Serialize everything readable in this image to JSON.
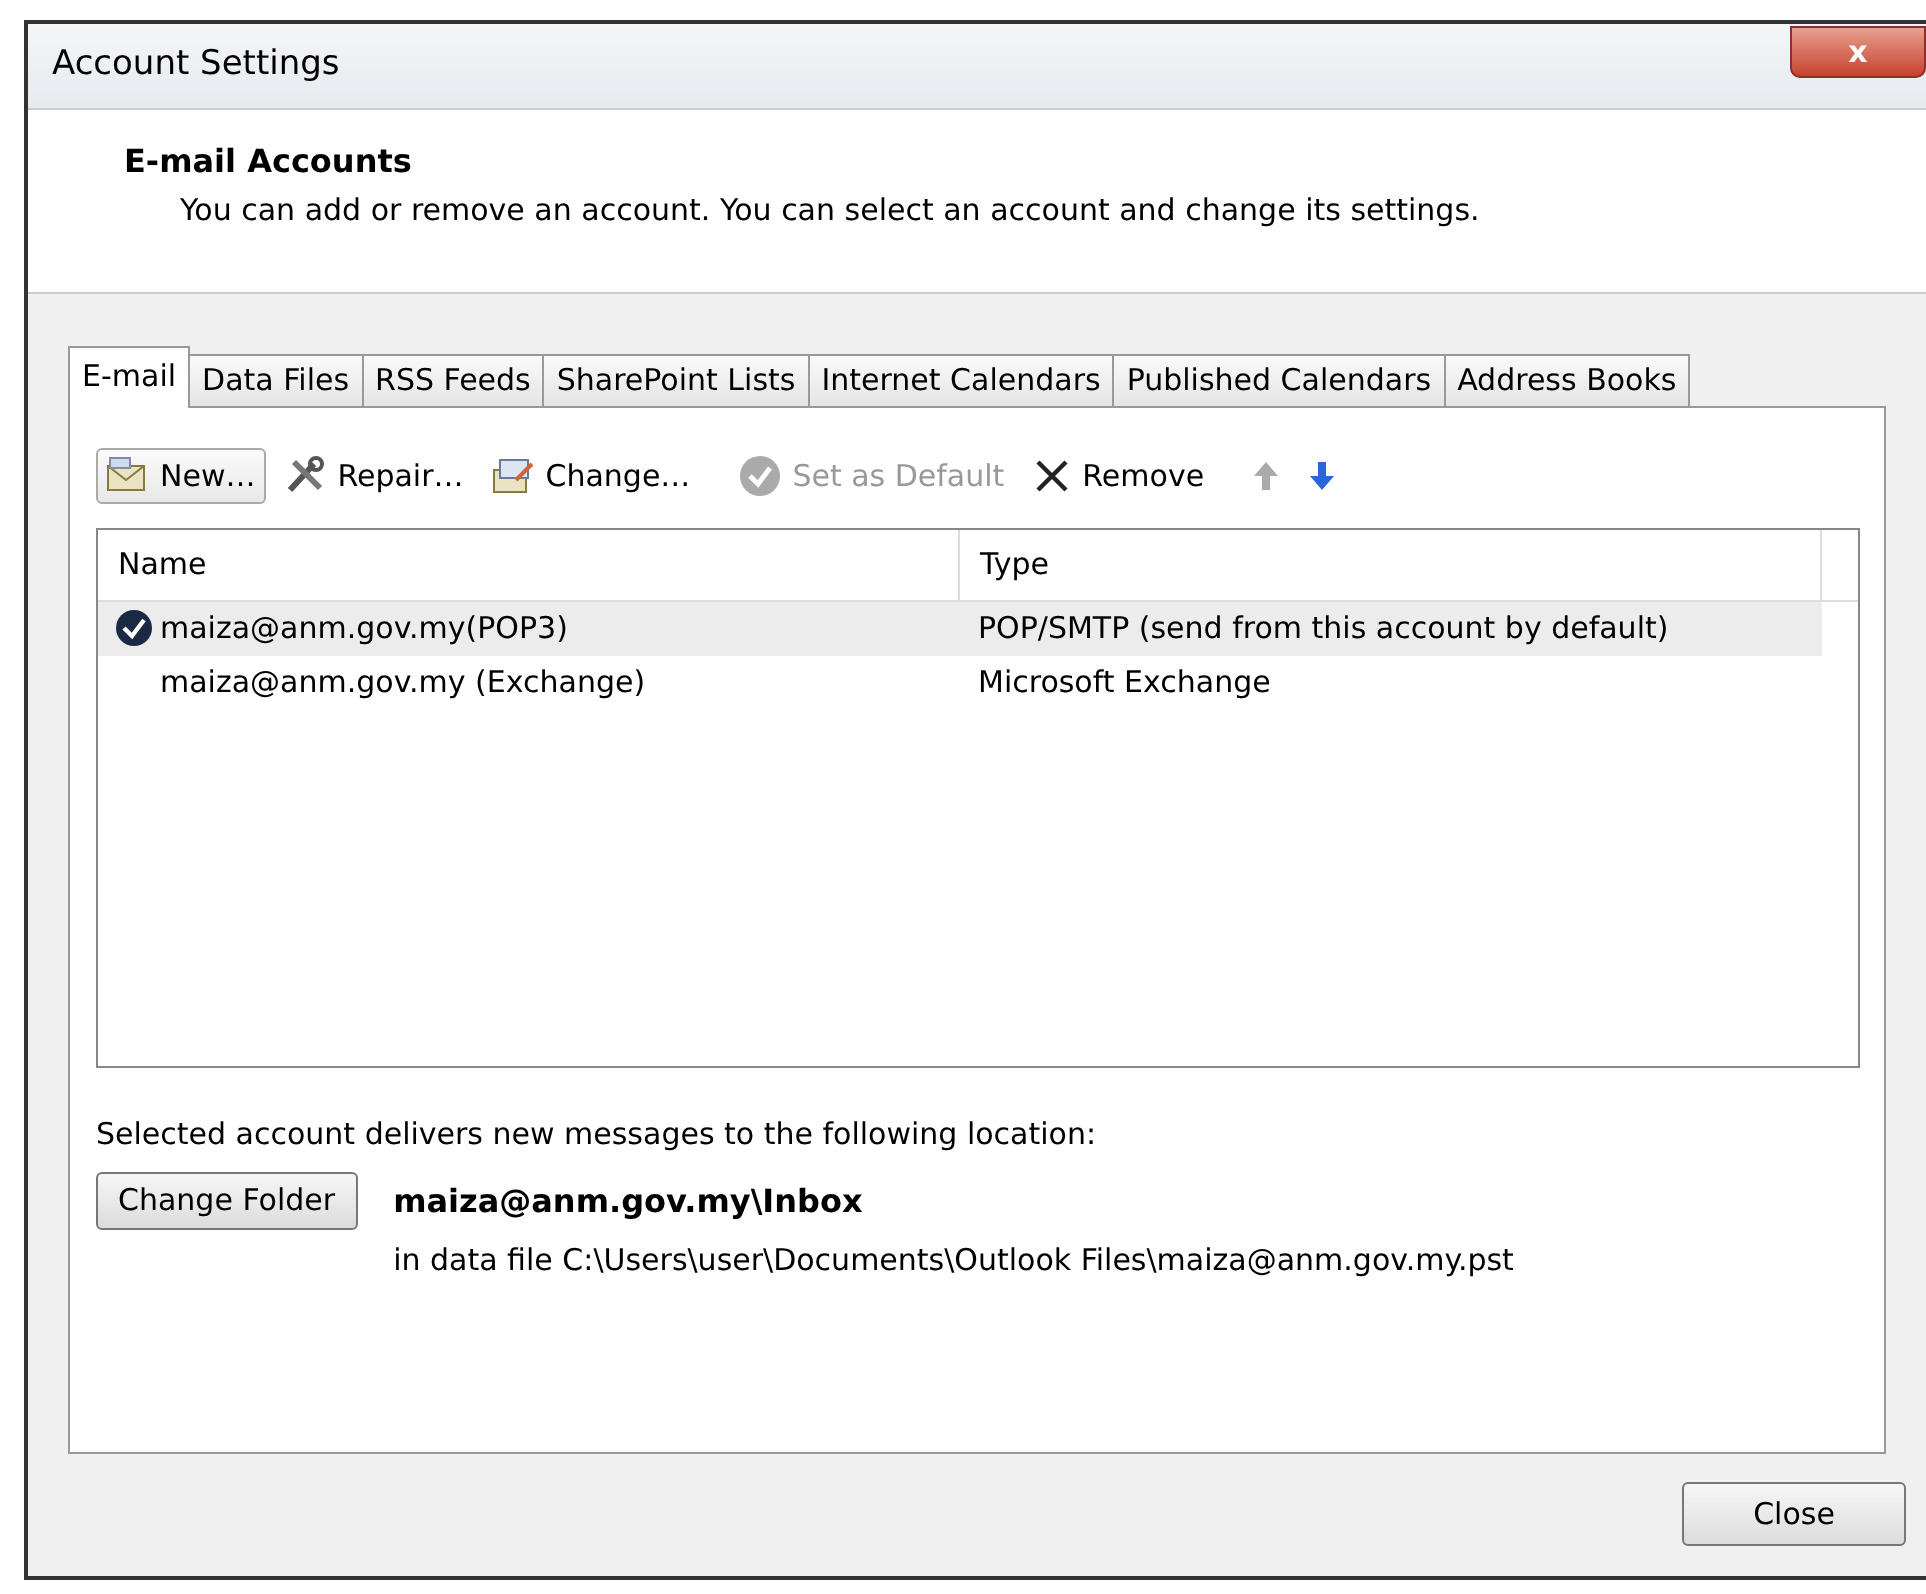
{
  "window": {
    "title": "Account Settings",
    "close_glyph": "x"
  },
  "header": {
    "title": "E-mail Accounts",
    "description": "You can add or remove an account. You can select an account and change its settings."
  },
  "tabs": [
    {
      "label": "E-mail",
      "selected": true
    },
    {
      "label": "Data Files",
      "selected": false
    },
    {
      "label": "RSS Feeds",
      "selected": false
    },
    {
      "label": "SharePoint Lists",
      "selected": false
    },
    {
      "label": "Internet Calendars",
      "selected": false
    },
    {
      "label": "Published Calendars",
      "selected": false
    },
    {
      "label": "Address Books",
      "selected": false
    }
  ],
  "toolbar": [
    {
      "kind": "new",
      "label": "New…",
      "disabled": false
    },
    {
      "kind": "repair",
      "label": "Repair…",
      "disabled": false
    },
    {
      "kind": "change",
      "label": "Change…",
      "disabled": false
    },
    {
      "kind": "default",
      "label": "Set as Default",
      "disabled": true
    },
    {
      "kind": "remove",
      "label": "Remove",
      "disabled": false
    },
    {
      "kind": "up",
      "disabled": true
    },
    {
      "kind": "down",
      "disabled": false
    }
  ],
  "table": {
    "columns": [
      "Name",
      "Type"
    ],
    "rows": [
      {
        "name": "maiza@anm.gov.my(POP3)",
        "type": "POP/SMTP (send from this account by default)",
        "selected": true,
        "default": true
      },
      {
        "name": "maiza@anm.gov.my (Exchange)",
        "type": "Microsoft Exchange",
        "selected": false,
        "default": false
      }
    ]
  },
  "delivery": {
    "label": "Selected account delivers new messages to the following location:",
    "button": "Change Folder",
    "folder": "maiza@anm.gov.my\\Inbox",
    "data_file": "in data file C:\\Users\\user\\Documents\\Outlook Files\\maiza@anm.gov.my.pst"
  },
  "buttons": [
    "Close"
  ]
}
